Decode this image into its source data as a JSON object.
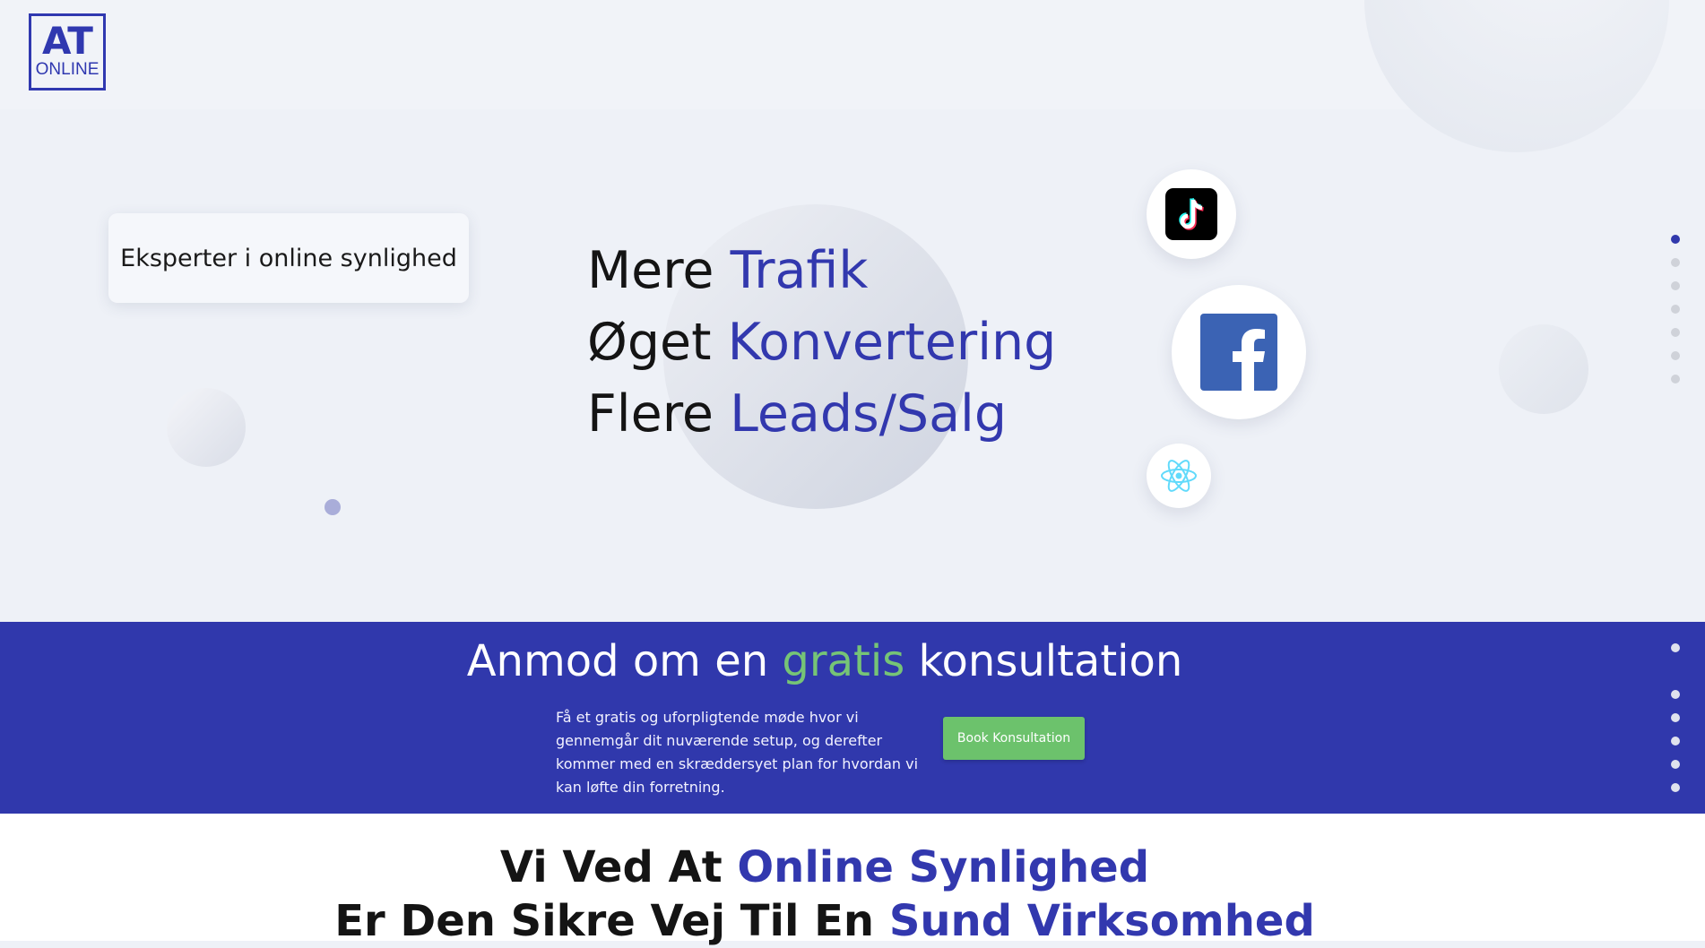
{
  "header": {
    "logo": {
      "top": "AT",
      "bottom": "ONLINE"
    }
  },
  "hero": {
    "tagline": "Eksperter i online synlighed",
    "lines": [
      {
        "lead": "Mere",
        "accent": "Trafik"
      },
      {
        "lead": "Øget",
        "accent": "Konvertering"
      },
      {
        "lead": "Flere",
        "accent": "Leads/Salg"
      }
    ],
    "social_icons": [
      "tiktok-icon",
      "facebook-icon",
      "react-icon"
    ]
  },
  "cta": {
    "title_before": "Anmod om en",
    "title_accent": "gratis",
    "title_after": "konsultation",
    "description": "Få et gratis og uforpligtende møde hvor vi gennemgår dit nuværende setup, og derefter kommer med en skræddersyet plan for hvordan vi kan løfte din forretning.",
    "button": "Book Konsultation"
  },
  "section": {
    "line1_before": "Vi Ved At",
    "line1_accent": "Online Synlighed",
    "line2_before": "Er Den Sikre Vej Til En",
    "line2_accent": "Sund Virksomhed"
  },
  "colors": {
    "brand_blue": "#3038ac",
    "accent_green": "#6cc26c",
    "dot_active": "#3038ac",
    "dot_inactive": "#cfd2d9"
  }
}
